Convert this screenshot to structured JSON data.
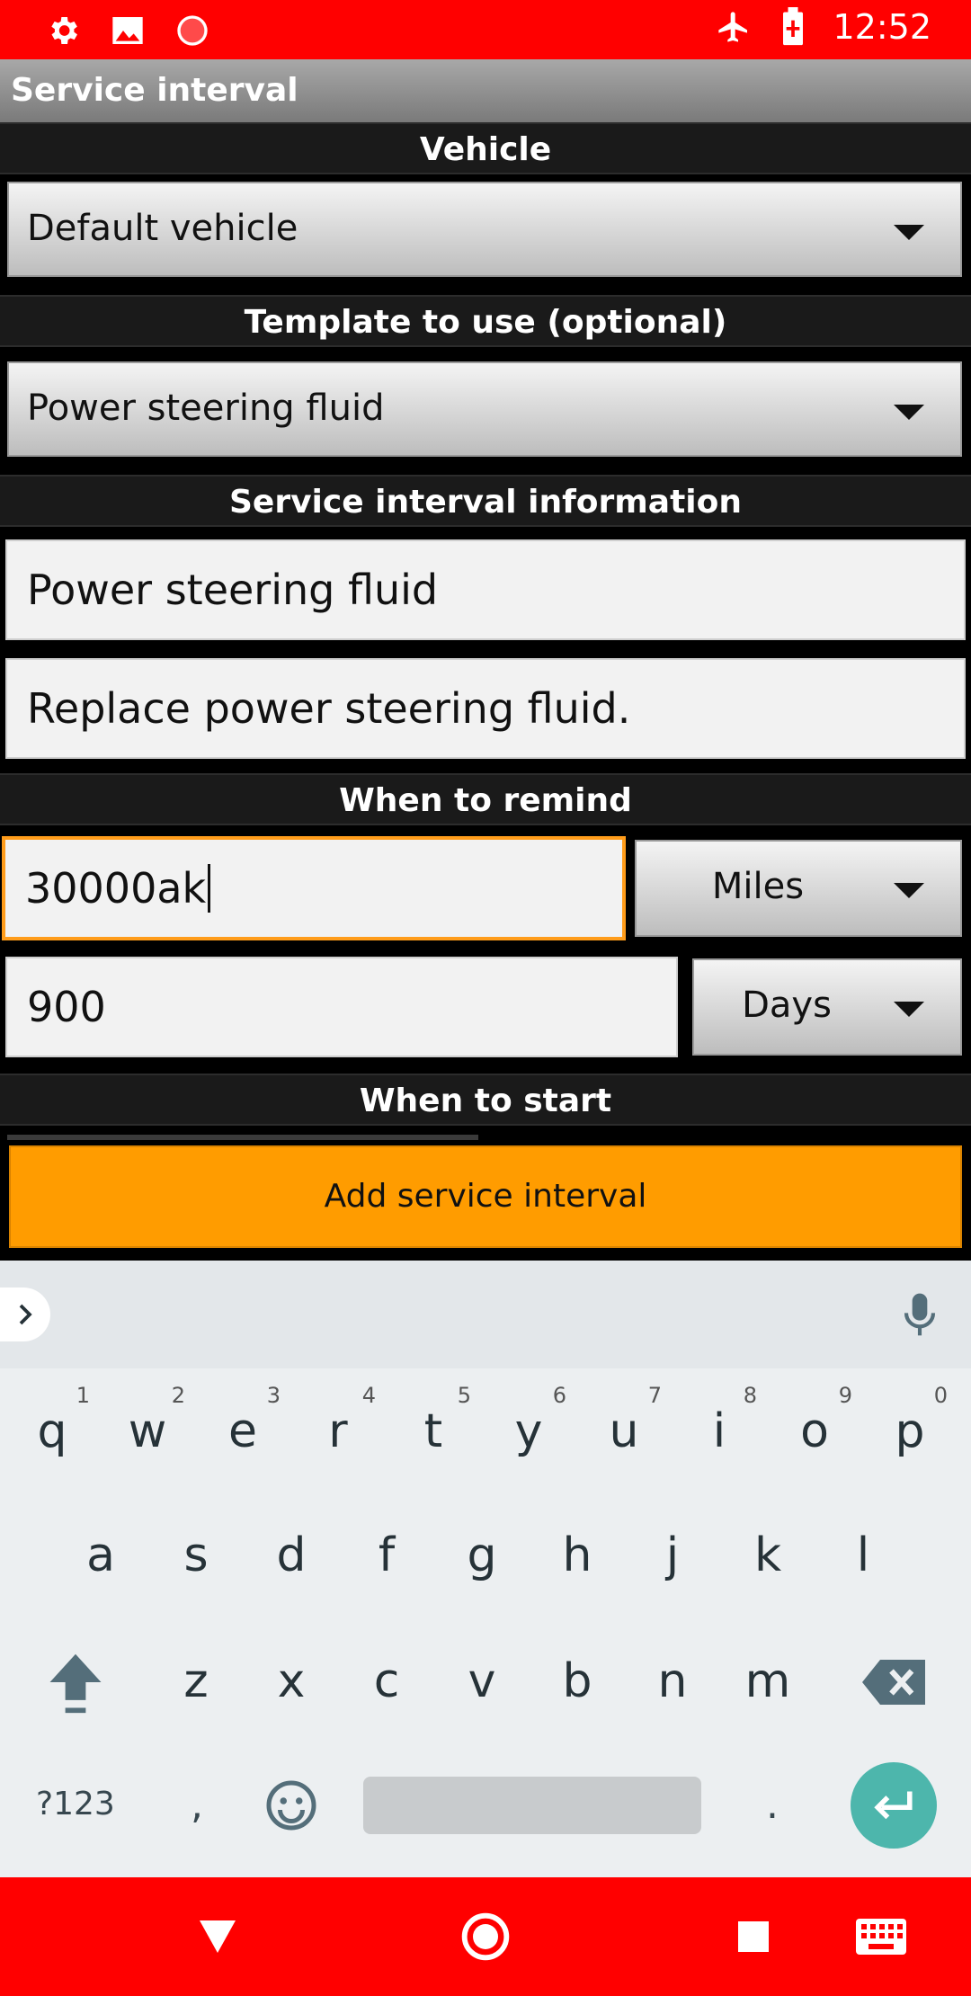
{
  "status_bar": {
    "time": "12:52",
    "left_icons": [
      "gear-icon",
      "image-icon",
      "record-icon"
    ],
    "right_icons": [
      "airplane-icon",
      "battery-charging-icon"
    ]
  },
  "app": {
    "title": "Service interval"
  },
  "sections": {
    "vehicle": "Vehicle",
    "template": "Template to use (optional)",
    "info": "Service interval information",
    "remind": "When to remind",
    "start": "When to start"
  },
  "form": {
    "vehicle_value": "Default vehicle",
    "template_value": "Power steering fluid",
    "name_value": "Power steering fluid",
    "description_value": "Replace power steering fluid.",
    "distance_value": "30000ak",
    "distance_unit": "Miles",
    "time_value": "900",
    "time_unit": "Days"
  },
  "button": {
    "add_label": "Add service interval"
  },
  "keyboard": {
    "row1": [
      {
        "key": "q",
        "hint": "1"
      },
      {
        "key": "w",
        "hint": "2"
      },
      {
        "key": "e",
        "hint": "3"
      },
      {
        "key": "r",
        "hint": "4"
      },
      {
        "key": "t",
        "hint": "5"
      },
      {
        "key": "y",
        "hint": "6"
      },
      {
        "key": "u",
        "hint": "7"
      },
      {
        "key": "i",
        "hint": "8"
      },
      {
        "key": "o",
        "hint": "9"
      },
      {
        "key": "p",
        "hint": "0"
      }
    ],
    "row2": [
      "a",
      "s",
      "d",
      "f",
      "g",
      "h",
      "j",
      "k",
      "l"
    ],
    "row3": [
      "z",
      "x",
      "c",
      "v",
      "b",
      "n",
      "m"
    ],
    "symbols_label": "?123",
    "comma": ",",
    "period": "."
  },
  "colors": {
    "status_bar": "#ff0000",
    "accent": "#ff9c00",
    "enter_key": "#4db6ac"
  }
}
